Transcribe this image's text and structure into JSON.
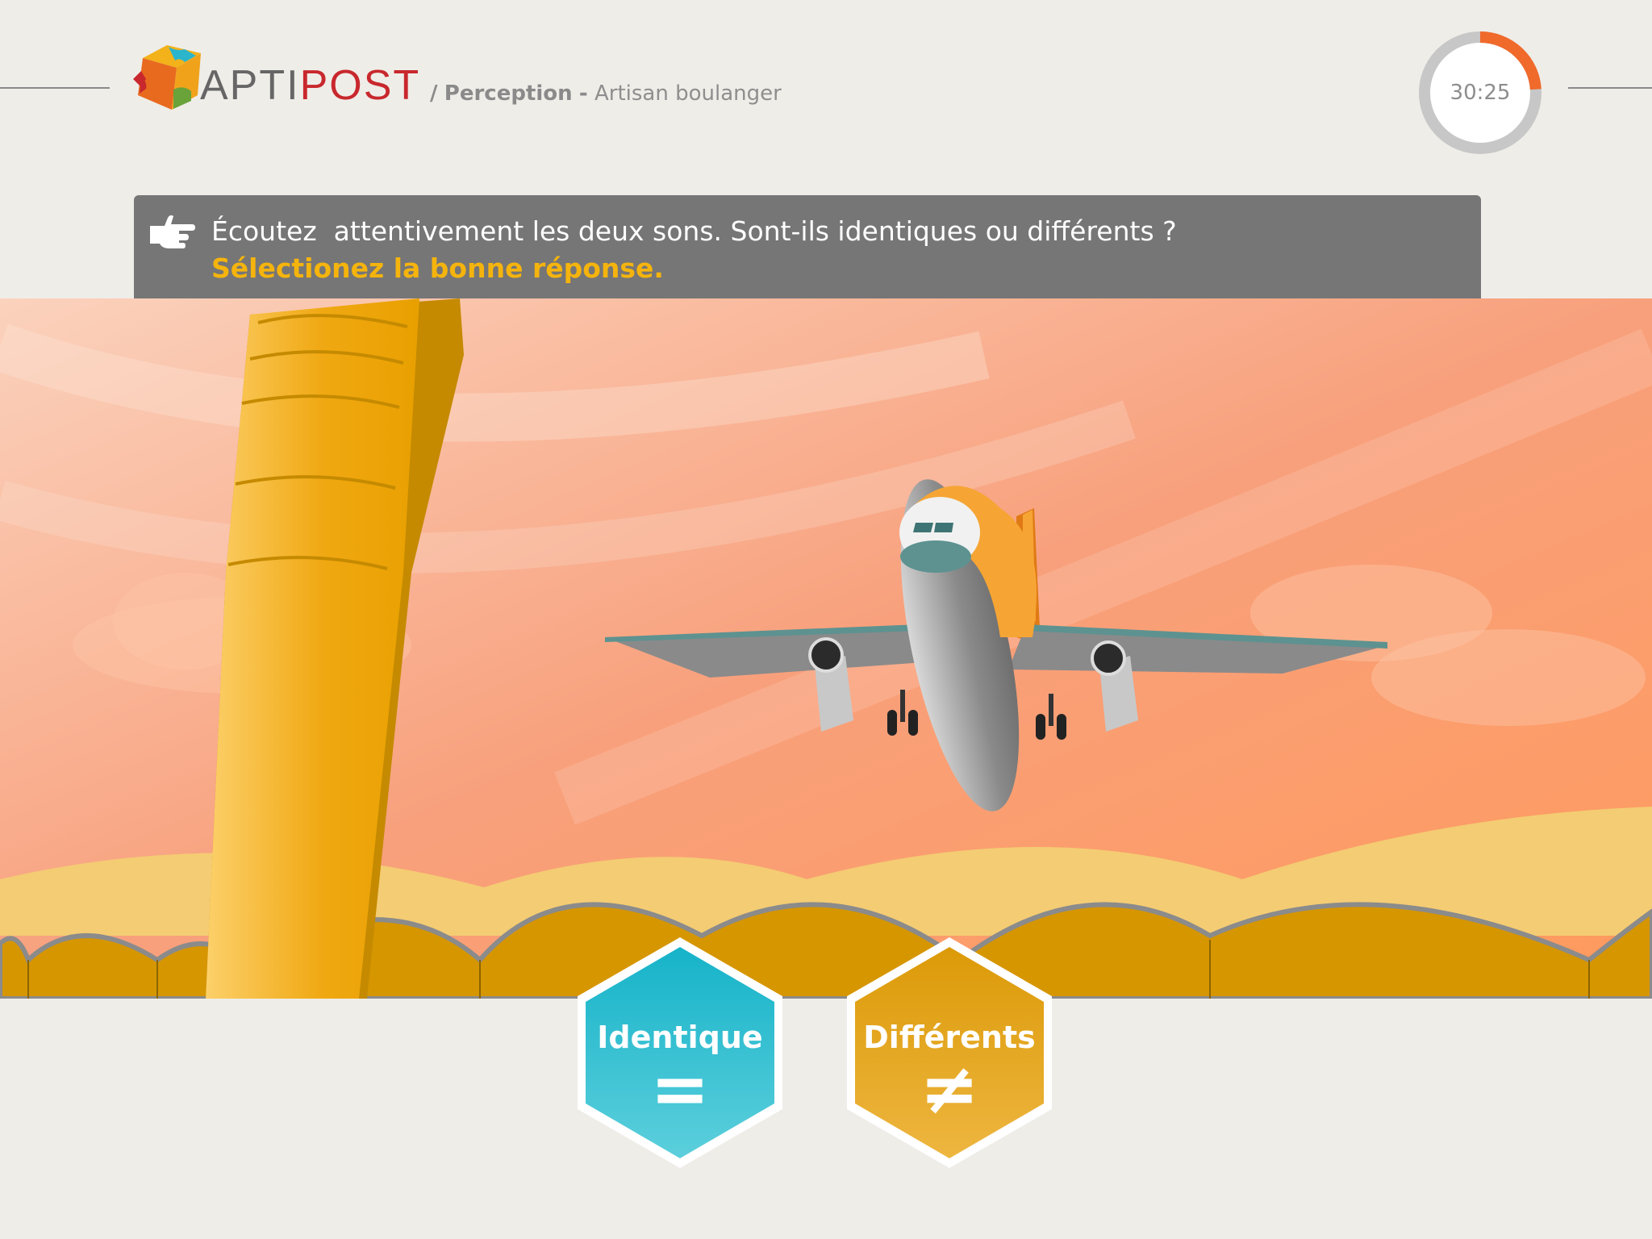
{
  "header": {
    "brand_first": "APTI",
    "brand_second": "POST",
    "breadcrumb_sep": "/",
    "breadcrumb_section": "Perception",
    "breadcrumb_dash": "-",
    "breadcrumb_page": "Artisan boulanger"
  },
  "timer": {
    "label": "30:25",
    "progress_fraction": 0.24,
    "progress_color": "#f06a2b",
    "track_color": "#c7c7c7"
  },
  "instruction": {
    "icon": "pointing-hand-icon",
    "line1": "Écoutez  attentivement les deux sons. Sont-ils identiques ou différents ?",
    "line2": "Sélectionez la bonne réponse."
  },
  "answers": [
    {
      "label": "Identique",
      "symbol": "=",
      "color": "#16b3c9"
    },
    {
      "label": "Différents",
      "symbol": "≠",
      "color": "#dc9a08"
    }
  ],
  "colors": {
    "accent_yellow": "#f5b40d",
    "instruction_bg": "#767676"
  }
}
